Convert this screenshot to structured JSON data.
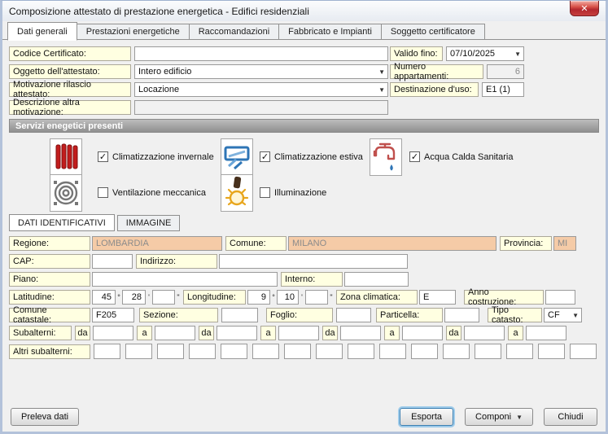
{
  "window": {
    "title": "Composizione attestato di prestazione energetica - Edifici residenziali",
    "close_glyph": "✕"
  },
  "glyphs": {
    "check": "✓",
    "dropdown_arrow": "▼",
    "degree": "°",
    "minute": "'",
    "second": "\""
  },
  "tabs": [
    "Dati generali",
    "Prestazioni energetiche",
    "Raccomandazioni",
    "Fabbricato e Impianti",
    "Soggetto certificatore"
  ],
  "form_top": {
    "codice_label": "Codice Certificato:",
    "codice_value": "",
    "valido_label": "Valido fino:",
    "valido_value": "07/10/2025",
    "oggetto_label": "Oggetto dell'attestato:",
    "oggetto_value": "Intero edificio",
    "numero_label": "Numero appartamenti:",
    "numero_value": "6",
    "motivazione_label": "Motivazione rilascio attestato:",
    "motivazione_value": "Locazione",
    "destinazione_label": "Destinazione d'uso:",
    "destinazione_value": "E1 (1)",
    "descrizione_label": "Descrizione altra motivazione:",
    "descrizione_value": ""
  },
  "servizi": {
    "header": "Servizi enegetici presenti",
    "items": [
      {
        "icon": "radiator-icon",
        "label": "Climatizzazione invernale",
        "checked": true
      },
      {
        "icon": "air-conditioner-icon",
        "label": "Climatizzazione estiva",
        "checked": true
      },
      {
        "icon": "faucet-icon",
        "label": "Acqua Calda Sanitaria",
        "checked": true
      },
      {
        "icon": "fan-icon",
        "label": "Ventilazione meccanica",
        "checked": false
      },
      {
        "icon": "bulb-icon",
        "label": "Illuminazione",
        "checked": false
      }
    ]
  },
  "subtabs": [
    {
      "label": "DATI IDENTIFICATIVI",
      "active": true
    },
    {
      "label": "IMMAGINE",
      "active": false
    }
  ],
  "identificativi": {
    "regione_label": "Regione:",
    "regione_value": "LOMBARDIA",
    "comune_label": "Comune:",
    "comune_value": "MILANO",
    "provincia_label": "Provincia:",
    "provincia_value": "MI",
    "cap_label": "CAP:",
    "cap_value": "",
    "indirizzo_label": "Indirizzo:",
    "indirizzo_value": "",
    "piano_label": "Piano:",
    "piano_value": "",
    "interno_label": "Interno:",
    "interno_value": "",
    "latitudine_label": "Latitudine:",
    "lat_deg": "45",
    "lat_min": "28",
    "lat_sec": "",
    "longitudine_label": "Longitudine:",
    "lon_deg": "9",
    "lon_min": "10",
    "lon_sec": "",
    "zona_label": "Zona climatica:",
    "zona_value": "E",
    "anno_label": "Anno costruzione:",
    "anno_value": "",
    "comune_catastale_label": "Comune catastale:",
    "comune_catastale_value": "F205",
    "sezione_label": "Sezione:",
    "sezione_value": "",
    "foglio_label": "Foglio:",
    "foglio_value": "",
    "particella_label": "Particella:",
    "particella_value": "",
    "tipo_catasto_label": "Tipo catasto:",
    "tipo_catasto_value": "CF",
    "subalterni_label": "Subalterni:",
    "da_label": "da",
    "a_label": "a",
    "subalterni_pairs": 4,
    "altri_label": "Altri subalterni:",
    "altri_box_count": 16
  },
  "footer": {
    "preleva": "Preleva dati",
    "esporta": "Esporta",
    "componi": "Componi",
    "chiudi": "Chiudi"
  },
  "colors": {
    "label_bg": "#ffffe1",
    "readonly_bg": "#f5cba7",
    "close_red": "#b3282e",
    "section_bar": "#9a9a9a"
  }
}
